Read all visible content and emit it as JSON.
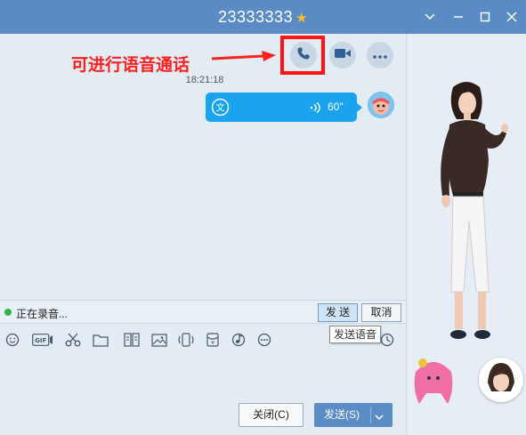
{
  "window": {
    "title": "23333333"
  },
  "annotation": {
    "text": "可进行语音通话"
  },
  "chat": {
    "timestamp": "18:21:18",
    "voice_message": {
      "duration": "60\""
    }
  },
  "recording": {
    "status": "正在录音...",
    "send_label": "发 送",
    "cancel_label": "取消",
    "tooltip": "发送语音"
  },
  "footer": {
    "close_label": "关闭(C)",
    "send_label": "发送(S)"
  },
  "colors": {
    "titlebar": "#5b8bc4",
    "accent": "#1aa3ee",
    "annotation": "#ff2020"
  },
  "icons": [
    "star-icon",
    "minimize-icon",
    "maximize-icon",
    "close-icon",
    "dropdown-icon",
    "voice-call-icon",
    "video-call-icon",
    "more-icon",
    "translate-icon",
    "sound-wave-icon",
    "emoji-icon",
    "gif-icon",
    "scissors-icon",
    "folder-icon",
    "doc-icon",
    "image-icon",
    "shake-icon",
    "red-packet-icon",
    "music-icon",
    "more-tools-icon"
  ]
}
